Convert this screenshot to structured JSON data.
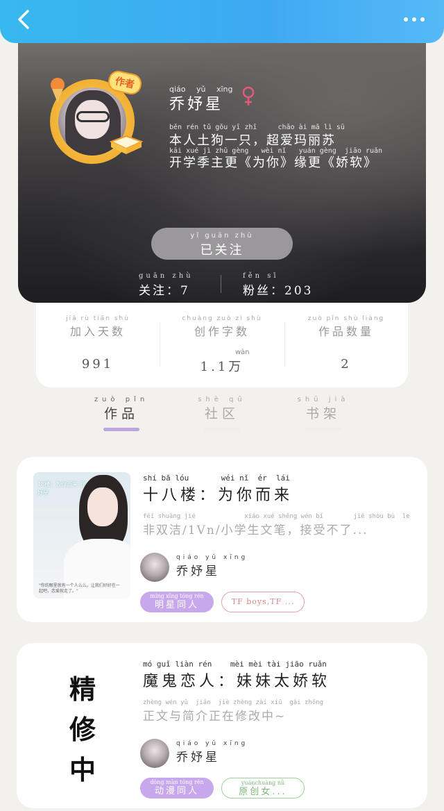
{
  "header": {
    "back_icon": "chevron-left-icon",
    "more_icon": "more-dots-icon"
  },
  "profile": {
    "author_badge": "作者",
    "name_py": "qiáo yǔ xīng",
    "name": "乔妤星",
    "gender": "female",
    "bio_line1_py": "běn rén tǔ gǒu yī zhī     chāo ài mǎ lì sū",
    "bio_line1": "本人土狗一只，超爱玛丽苏",
    "bio_line2_py": "kāi xué jì zhǔ gèng   wèi nǐ   yuán gèng  jiāo ruǎn",
    "bio_line2": "开学季主更《为你》缘更《娇软》",
    "follow_btn_py": "yǐ guān zhù",
    "follow_btn": "已关注",
    "following_py": "guān zhù",
    "following": "关注：7",
    "fans_py": "fěn sī",
    "fans": "粉丝：203"
  },
  "stats": [
    {
      "label_py": "jiā rù tiān shù",
      "label": "加入天数",
      "value": "991",
      "value_py": ""
    },
    {
      "label_py": "chuàng zuò zì shù",
      "label": "创作字数",
      "value": "1.1万",
      "value_py": "wàn"
    },
    {
      "label_py": "zuò pǐn shù liàng",
      "label": "作品数量",
      "value": "2",
      "value_py": ""
    }
  ],
  "tabs": [
    {
      "py": "zuò pǐn",
      "label": "作品",
      "active": true
    },
    {
      "py": "shè qū",
      "label": "社区",
      "active": false
    },
    {
      "py": "shū jià",
      "label": "书架",
      "active": false
    }
  ],
  "works": [
    {
      "title_py": "shí bā lóu       wéi nǐ  ér  lái",
      "title": "十八楼：为你而来",
      "desc_py": "fēi shuāng jié             xiǎo xué shēng wén bǐ        jiē shòu bù  le",
      "desc": "非双洁/1Vn/小学生文笔，接受不了...",
      "author_py": "qiáo yǔ xīng",
      "author": "乔妤星",
      "cover_title": "18楼：为你而来 乔妤星",
      "cover_caption": "\"你的眼里就有一个人么么，让我们好好在一起吧，恋爱就走了。\"",
      "tags": [
        {
          "py": "míng xīng tóng rén",
          "label": "明星同人",
          "style": "purple"
        },
        {
          "py": "",
          "label": "TF boys,TF ...",
          "style": "red"
        }
      ]
    },
    {
      "status": "精修中",
      "title_py": "mó guǐ liàn rén    mèi mèi tài jiāo ruǎn",
      "title": "魔鬼恋人：妹妹太娇软",
      "desc_py": "zhèng wén yǔ  jiǎn  jiè zhèng zài xiū  gǎi zhōng",
      "desc": "正文与简介正在修改中~",
      "author_py": "qiáo yǔ xīng",
      "author": "乔妤星",
      "tags": [
        {
          "py": "dòng màn tóng rén",
          "label": "动漫同人",
          "style": "purple"
        },
        {
          "py": "yuánchuàng nǚ",
          "label": "原创女...",
          "style": "green"
        }
      ]
    }
  ],
  "colors": {
    "header": "#3ea9f3",
    "accent_purple": "#c8a8ec",
    "tab_active_bar": "#bca6de",
    "gender": "#e55a7a"
  }
}
